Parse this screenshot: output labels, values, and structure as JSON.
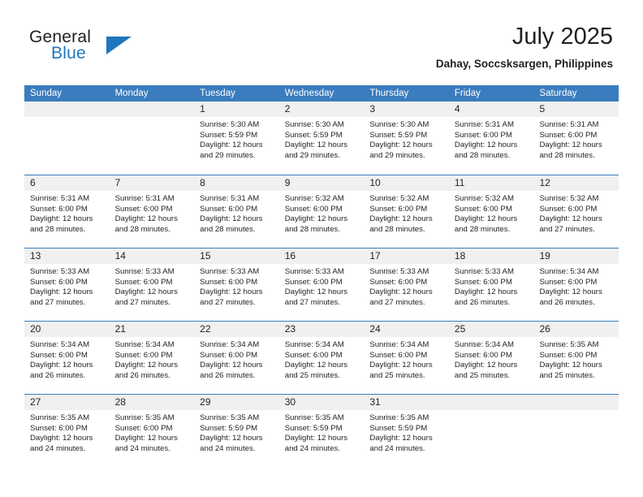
{
  "brand": {
    "name_top": "General",
    "name_bottom": "Blue",
    "accent_color": "#1f76bd",
    "triangle_icon": "triangle-icon"
  },
  "header": {
    "title": "July 2025",
    "location": "Dahay, Soccsksargen, Philippines"
  },
  "theme": {
    "header_row_bg": "#3a7cbe",
    "day_band_bg": "#f0f0f0",
    "text_color": "#231f20",
    "separator_color": "#3a7cbe"
  },
  "weekdays": [
    "Sunday",
    "Monday",
    "Tuesday",
    "Wednesday",
    "Thursday",
    "Friday",
    "Saturday"
  ],
  "weeks": [
    [
      {
        "date": "",
        "empty": true,
        "lines": []
      },
      {
        "date": "",
        "empty": true,
        "lines": []
      },
      {
        "date": "1",
        "empty": false,
        "lines": [
          "Sunrise: 5:30 AM",
          "Sunset: 5:59 PM",
          "Daylight: 12 hours",
          "and 29 minutes."
        ]
      },
      {
        "date": "2",
        "empty": false,
        "lines": [
          "Sunrise: 5:30 AM",
          "Sunset: 5:59 PM",
          "Daylight: 12 hours",
          "and 29 minutes."
        ]
      },
      {
        "date": "3",
        "empty": false,
        "lines": [
          "Sunrise: 5:30 AM",
          "Sunset: 5:59 PM",
          "Daylight: 12 hours",
          "and 29 minutes."
        ]
      },
      {
        "date": "4",
        "empty": false,
        "lines": [
          "Sunrise: 5:31 AM",
          "Sunset: 6:00 PM",
          "Daylight: 12 hours",
          "and 28 minutes."
        ]
      },
      {
        "date": "5",
        "empty": false,
        "lines": [
          "Sunrise: 5:31 AM",
          "Sunset: 6:00 PM",
          "Daylight: 12 hours",
          "and 28 minutes."
        ]
      }
    ],
    [
      {
        "date": "6",
        "empty": false,
        "lines": [
          "Sunrise: 5:31 AM",
          "Sunset: 6:00 PM",
          "Daylight: 12 hours",
          "and 28 minutes."
        ]
      },
      {
        "date": "7",
        "empty": false,
        "lines": [
          "Sunrise: 5:31 AM",
          "Sunset: 6:00 PM",
          "Daylight: 12 hours",
          "and 28 minutes."
        ]
      },
      {
        "date": "8",
        "empty": false,
        "lines": [
          "Sunrise: 5:31 AM",
          "Sunset: 6:00 PM",
          "Daylight: 12 hours",
          "and 28 minutes."
        ]
      },
      {
        "date": "9",
        "empty": false,
        "lines": [
          "Sunrise: 5:32 AM",
          "Sunset: 6:00 PM",
          "Daylight: 12 hours",
          "and 28 minutes."
        ]
      },
      {
        "date": "10",
        "empty": false,
        "lines": [
          "Sunrise: 5:32 AM",
          "Sunset: 6:00 PM",
          "Daylight: 12 hours",
          "and 28 minutes."
        ]
      },
      {
        "date": "11",
        "empty": false,
        "lines": [
          "Sunrise: 5:32 AM",
          "Sunset: 6:00 PM",
          "Daylight: 12 hours",
          "and 28 minutes."
        ]
      },
      {
        "date": "12",
        "empty": false,
        "lines": [
          "Sunrise: 5:32 AM",
          "Sunset: 6:00 PM",
          "Daylight: 12 hours",
          "and 27 minutes."
        ]
      }
    ],
    [
      {
        "date": "13",
        "empty": false,
        "lines": [
          "Sunrise: 5:33 AM",
          "Sunset: 6:00 PM",
          "Daylight: 12 hours",
          "and 27 minutes."
        ]
      },
      {
        "date": "14",
        "empty": false,
        "lines": [
          "Sunrise: 5:33 AM",
          "Sunset: 6:00 PM",
          "Daylight: 12 hours",
          "and 27 minutes."
        ]
      },
      {
        "date": "15",
        "empty": false,
        "lines": [
          "Sunrise: 5:33 AM",
          "Sunset: 6:00 PM",
          "Daylight: 12 hours",
          "and 27 minutes."
        ]
      },
      {
        "date": "16",
        "empty": false,
        "lines": [
          "Sunrise: 5:33 AM",
          "Sunset: 6:00 PM",
          "Daylight: 12 hours",
          "and 27 minutes."
        ]
      },
      {
        "date": "17",
        "empty": false,
        "lines": [
          "Sunrise: 5:33 AM",
          "Sunset: 6:00 PM",
          "Daylight: 12 hours",
          "and 27 minutes."
        ]
      },
      {
        "date": "18",
        "empty": false,
        "lines": [
          "Sunrise: 5:33 AM",
          "Sunset: 6:00 PM",
          "Daylight: 12 hours",
          "and 26 minutes."
        ]
      },
      {
        "date": "19",
        "empty": false,
        "lines": [
          "Sunrise: 5:34 AM",
          "Sunset: 6:00 PM",
          "Daylight: 12 hours",
          "and 26 minutes."
        ]
      }
    ],
    [
      {
        "date": "20",
        "empty": false,
        "lines": [
          "Sunrise: 5:34 AM",
          "Sunset: 6:00 PM",
          "Daylight: 12 hours",
          "and 26 minutes."
        ]
      },
      {
        "date": "21",
        "empty": false,
        "lines": [
          "Sunrise: 5:34 AM",
          "Sunset: 6:00 PM",
          "Daylight: 12 hours",
          "and 26 minutes."
        ]
      },
      {
        "date": "22",
        "empty": false,
        "lines": [
          "Sunrise: 5:34 AM",
          "Sunset: 6:00 PM",
          "Daylight: 12 hours",
          "and 26 minutes."
        ]
      },
      {
        "date": "23",
        "empty": false,
        "lines": [
          "Sunrise: 5:34 AM",
          "Sunset: 6:00 PM",
          "Daylight: 12 hours",
          "and 25 minutes."
        ]
      },
      {
        "date": "24",
        "empty": false,
        "lines": [
          "Sunrise: 5:34 AM",
          "Sunset: 6:00 PM",
          "Daylight: 12 hours",
          "and 25 minutes."
        ]
      },
      {
        "date": "25",
        "empty": false,
        "lines": [
          "Sunrise: 5:34 AM",
          "Sunset: 6:00 PM",
          "Daylight: 12 hours",
          "and 25 minutes."
        ]
      },
      {
        "date": "26",
        "empty": false,
        "lines": [
          "Sunrise: 5:35 AM",
          "Sunset: 6:00 PM",
          "Daylight: 12 hours",
          "and 25 minutes."
        ]
      }
    ],
    [
      {
        "date": "27",
        "empty": false,
        "lines": [
          "Sunrise: 5:35 AM",
          "Sunset: 6:00 PM",
          "Daylight: 12 hours",
          "and 24 minutes."
        ]
      },
      {
        "date": "28",
        "empty": false,
        "lines": [
          "Sunrise: 5:35 AM",
          "Sunset: 6:00 PM",
          "Daylight: 12 hours",
          "and 24 minutes."
        ]
      },
      {
        "date": "29",
        "empty": false,
        "lines": [
          "Sunrise: 5:35 AM",
          "Sunset: 5:59 PM",
          "Daylight: 12 hours",
          "and 24 minutes."
        ]
      },
      {
        "date": "30",
        "empty": false,
        "lines": [
          "Sunrise: 5:35 AM",
          "Sunset: 5:59 PM",
          "Daylight: 12 hours",
          "and 24 minutes."
        ]
      },
      {
        "date": "31",
        "empty": false,
        "lines": [
          "Sunrise: 5:35 AM",
          "Sunset: 5:59 PM",
          "Daylight: 12 hours",
          "and 24 minutes."
        ]
      },
      {
        "date": "",
        "empty": true,
        "lines": []
      },
      {
        "date": "",
        "empty": true,
        "lines": []
      }
    ]
  ]
}
